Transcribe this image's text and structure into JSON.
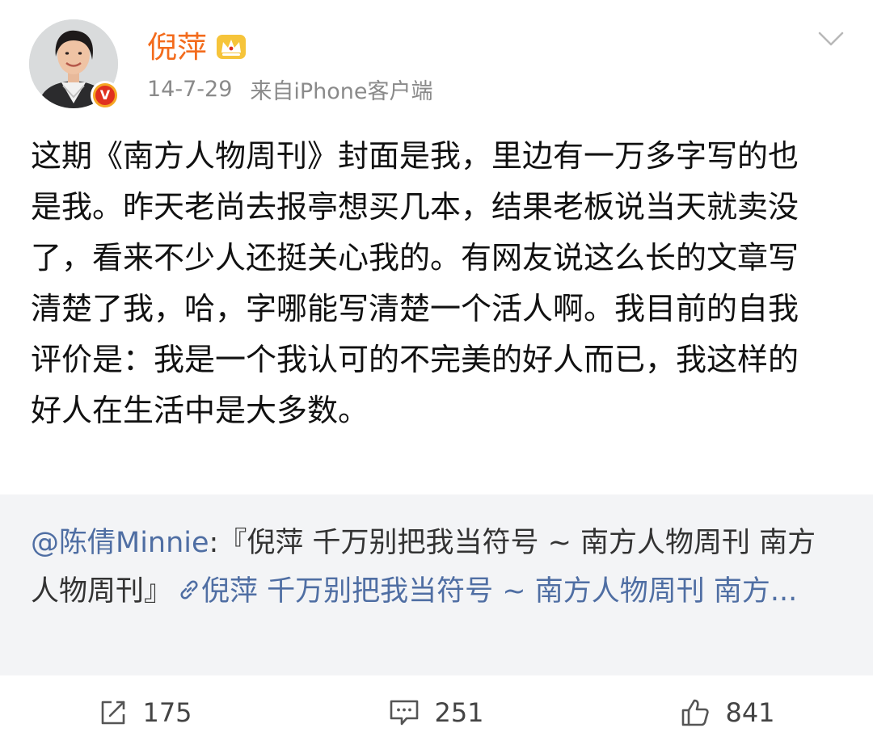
{
  "author": {
    "name": "倪萍",
    "date": "14-7-29",
    "source": "来自iPhone客户端",
    "avatar_icon": "person-avatar",
    "badge_icon": "verified-v-icon",
    "badge_letter": "V",
    "member_icon": "crown-icon"
  },
  "post": {
    "text": "这期《南方人物周刊》封面是我，里边有一万多字写的也是我。昨天老尚去报亭想买几本，结果老板说当天就卖没了，看来不少人还挺关心我的。有网友说这么长的文章写清楚了我，哈，字哪能写清楚一个活人啊。我目前的自我评价是：我是一个我认可的不完美的好人而已，我这样的好人在生活中是大多数。"
  },
  "repost": {
    "mention": "@陈倩Minnie",
    "text_part": ":『倪萍 千万别把我当符号 ~ 南方人物周刊 南方人物周刊』",
    "link_text": "倪萍 千万别把我当符号 ~ 南方人物周刊 南方..."
  },
  "actions": {
    "share_count": "175",
    "comment_count": "251",
    "like_count": "841"
  },
  "colors": {
    "username": "#f36b1c",
    "link": "#4f6ea3",
    "repost_bg": "#f3f4f6",
    "meta": "#8a8a8a"
  }
}
